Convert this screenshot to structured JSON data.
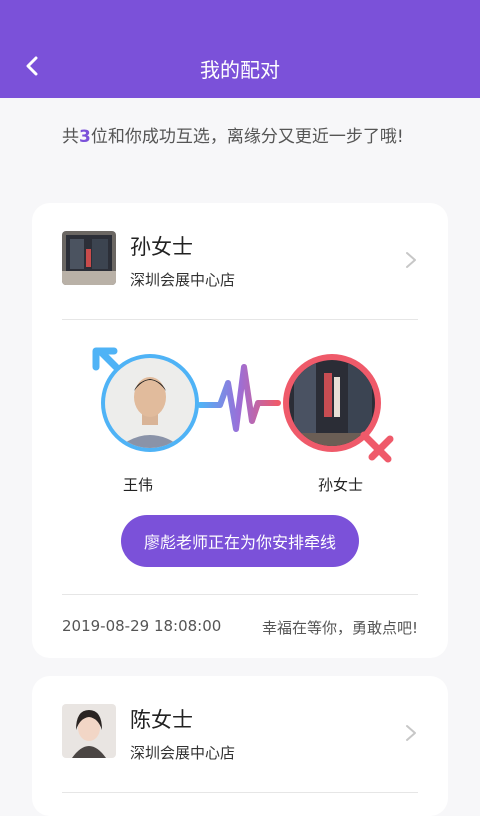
{
  "header": {
    "title": "我的配对"
  },
  "intro": {
    "prefix": "共",
    "count": "3",
    "suffix": "位和你成功互选，离缘分又更近一步了哦!"
  },
  "matches": [
    {
      "name": "孙女士",
      "store": "深圳会展中心店",
      "male_name": "王伟",
      "female_name": "孙女士",
      "cta": "廖彪老师正在为你安排牵线",
      "date": "2019-08-29 18:08:00",
      "slogan": "幸福在等你，勇敢点吧!"
    },
    {
      "name": "陈女士",
      "store": "深圳会展中心店"
    }
  ],
  "colors": {
    "brand": "#7b51d9",
    "male": "#4fb3f6",
    "female": "#ef5a6a"
  }
}
